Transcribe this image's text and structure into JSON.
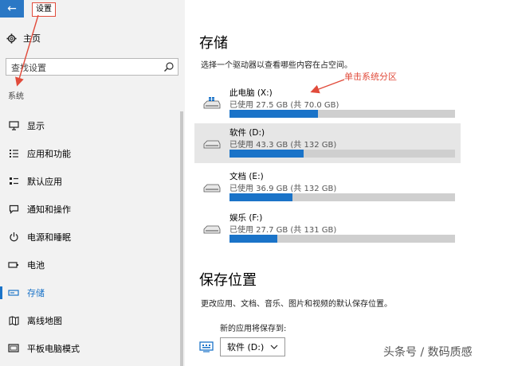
{
  "window": {
    "back_icon": "arrow-left-icon",
    "title": "设置"
  },
  "sidebar": {
    "home_icon": "gear-icon",
    "home_label": "主页",
    "search_placeholder": "查找设置",
    "search_icon": "search-icon",
    "section": "系统",
    "items": [
      {
        "label": "显示",
        "icon": "monitor-icon"
      },
      {
        "label": "应用和功能",
        "icon": "apps-list-icon"
      },
      {
        "label": "默认应用",
        "icon": "default-apps-icon"
      },
      {
        "label": "通知和操作",
        "icon": "notification-icon"
      },
      {
        "label": "电源和睡眠",
        "icon": "power-icon"
      },
      {
        "label": "电池",
        "icon": "battery-icon"
      },
      {
        "label": "存储",
        "icon": "storage-icon",
        "active": true
      },
      {
        "label": "离线地图",
        "icon": "map-icon"
      },
      {
        "label": "平板电脑模式",
        "icon": "tablet-icon"
      }
    ]
  },
  "main": {
    "title": "存储",
    "description": "选择一个驱动器以查看哪些内容在占空间。",
    "drives": [
      {
        "name": "此电脑 (X:)",
        "usage": "已使用 27.5 GB (共 70.0 GB)",
        "used_fraction": 0.393,
        "icon": "windows-drive-icon"
      },
      {
        "name": "软件 (D:)",
        "usage": "已使用 43.3 GB (共 132 GB)",
        "used_fraction": 0.328,
        "icon": "drive-icon"
      },
      {
        "name": "文档 (E:)",
        "usage": "已使用 36.9 GB (共 132 GB)",
        "used_fraction": 0.28,
        "icon": "drive-icon"
      },
      {
        "name": "娱乐 (F:)",
        "usage": "已使用 27.7 GB (共 131 GB)",
        "used_fraction": 0.211,
        "icon": "drive-icon"
      }
    ],
    "annotation": "单击系统分区",
    "save_title": "保存位置",
    "save_description": "更改应用、文档、音乐、图片和视频的默认保存位置。",
    "new_apps_label": "新的应用将保存到:",
    "new_apps_value": "软件 (D:)"
  },
  "watermark": "头条号 / 数码质感",
  "colors": {
    "accent": "#1a73c8",
    "back_button": "#2b78c5",
    "annotation": "#e14b3b",
    "bar_track": "#cfcfcf"
  }
}
